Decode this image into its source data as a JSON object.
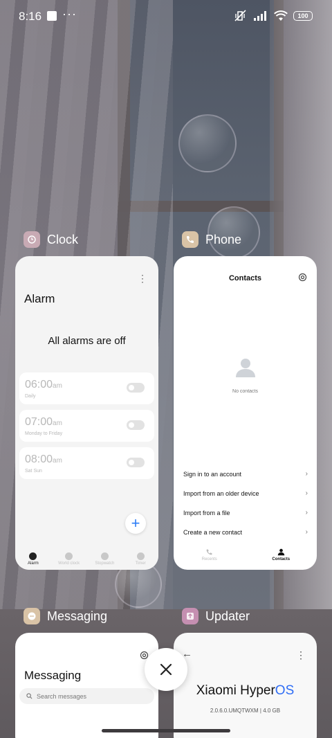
{
  "status_bar": {
    "time": "8:16",
    "more": "···",
    "battery": "100"
  },
  "apps": {
    "clock": {
      "name": "Clock",
      "icon": "alarm-clock-icon",
      "icon_color": "#c8aab4",
      "title": "Alarm",
      "empty_message": "All alarms are off",
      "alarms": [
        {
          "time": "06:00",
          "ampm": "am",
          "repeat": "Daily",
          "enabled": false
        },
        {
          "time": "07:00",
          "ampm": "am",
          "repeat": "Monday to Friday",
          "enabled": false
        },
        {
          "time": "08:00",
          "ampm": "am",
          "repeat": "Sat Sun",
          "enabled": false
        }
      ],
      "nav": [
        {
          "label": "Alarm",
          "icon": "alarm-icon",
          "active": true
        },
        {
          "label": "World clock",
          "icon": "world-clock-icon",
          "active": false
        },
        {
          "label": "Stopwatch",
          "icon": "stopwatch-icon",
          "active": false
        },
        {
          "label": "Timer",
          "icon": "hourglass-icon",
          "active": false
        }
      ]
    },
    "phone": {
      "name": "Phone",
      "icon": "phone-icon",
      "icon_color": "#d9c3a6",
      "title": "Contacts",
      "empty_message": "No contacts",
      "actions": [
        "Sign in to an account",
        "Import from an older device",
        "Import from a file",
        "Create a new contact"
      ],
      "nav": [
        {
          "label": "Recents",
          "icon": "phone-icon",
          "active": false
        },
        {
          "label": "Contacts",
          "icon": "person-icon",
          "active": true
        }
      ]
    },
    "messaging": {
      "name": "Messaging",
      "icon": "chat-bubble-icon",
      "icon_color": "#d9c3a6",
      "title": "Messaging",
      "search_placeholder": "Search messages"
    },
    "updater": {
      "name": "Updater",
      "icon": "updater-arrow-icon",
      "icon_color": "#c58fb1",
      "brand_main": "Xiaomi Hyper",
      "brand_os": "OS",
      "version": "2.0.6.0.UMQTWXM | 4.0 GB"
    }
  },
  "colors": {
    "accent_blue": "#2c7cf6",
    "hyperos_blue": "#2f6df5"
  }
}
